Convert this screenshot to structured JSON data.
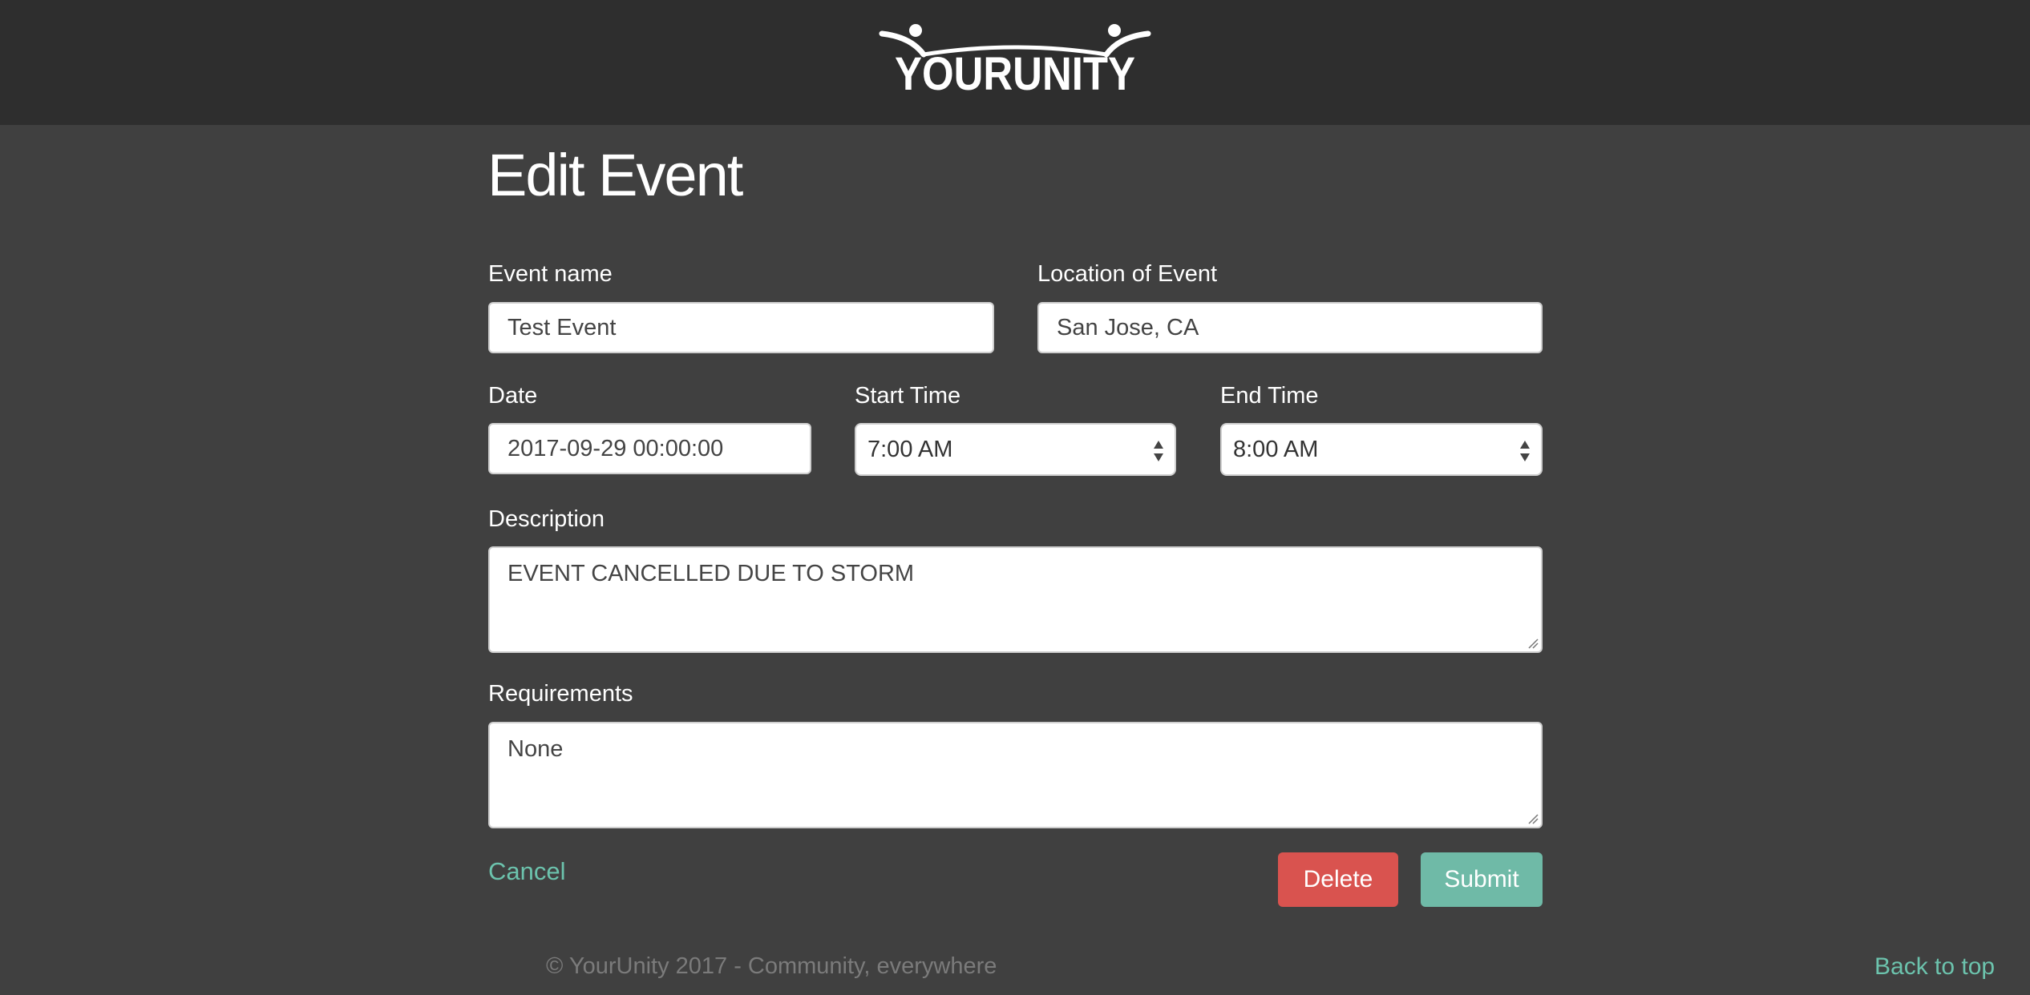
{
  "header": {
    "logo_text": "YOURUNITY"
  },
  "page": {
    "title": "Edit Event"
  },
  "form": {
    "event_name": {
      "label": "Event name",
      "value": "Test Event"
    },
    "location": {
      "label": "Location of Event",
      "value": "San Jose, CA"
    },
    "date": {
      "label": "Date",
      "value": "2017-09-29 00:00:00"
    },
    "start_time": {
      "label": "Start Time",
      "value": "7:00 AM"
    },
    "end_time": {
      "label": "End Time",
      "value": "8:00 AM"
    },
    "description": {
      "label": "Description",
      "value": "EVENT CANCELLED DUE TO STORM"
    },
    "requirements": {
      "label": "Requirements",
      "value": "None"
    }
  },
  "actions": {
    "cancel_label": "Cancel",
    "delete_label": "Delete",
    "submit_label": "Submit"
  },
  "footer": {
    "copyright": "© YourUnity 2017 - Community, everywhere",
    "back_to_top": "Back to top"
  },
  "colors": {
    "header_bg": "#2e2e2e",
    "page_bg": "#404040",
    "accent": "#6cc3ad",
    "delete": "#d9534f",
    "submit": "#6fbaa7"
  },
  "icons": {
    "select_arrows": "updown-arrows-icon",
    "resize_grip": "resize-grip-icon"
  }
}
